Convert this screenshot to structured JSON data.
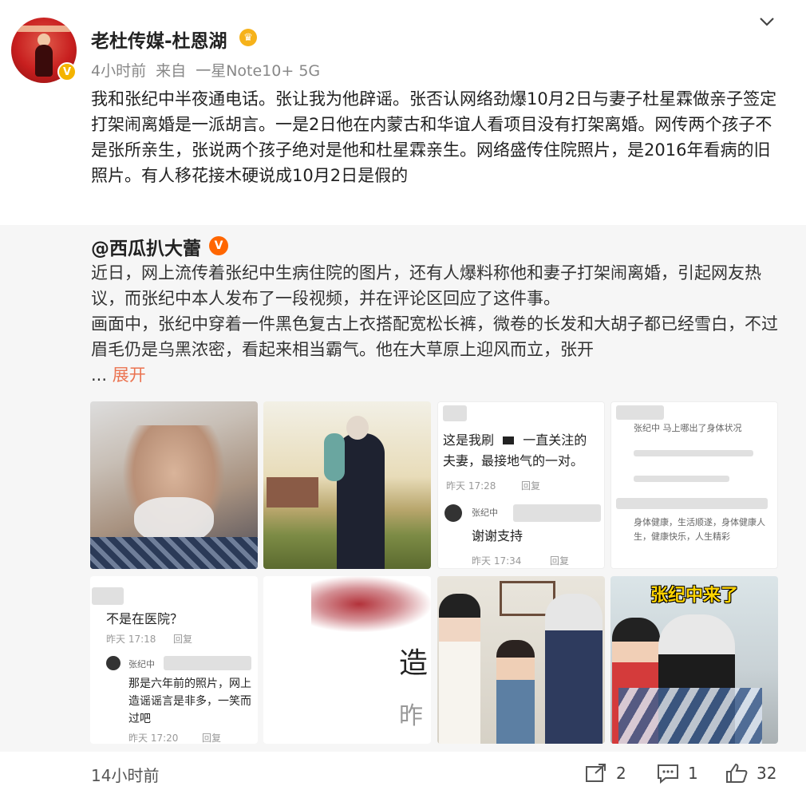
{
  "post": {
    "author": "老杜传媒-杜恩湖",
    "meta_time": "4小时前",
    "meta_source_label": "来自",
    "meta_device": "一星Note10+ 5G",
    "body": "我和张纪中半夜通电话。张让我为他辟谣。张否认网络劲爆10月2日与妻子杜星霖做亲子签定打架闹离婚是一派胡言。一是2日他在内蒙古和华谊人看项目没有打架离婚。网传两个孩子不是张所亲生，张说两个孩子绝对是他和杜星霖亲生。网络盛传住院照片，是2016年看病的旧照片。有人移花接木硬说成10月2日是假的"
  },
  "repost": {
    "author": "@西瓜扒大蕾",
    "text_p1": "近日，网上流传着张纪中生病住院的图片，还有人爆料称他和妻子打架闹离婚，引起网友热议，而张纪中本人发布了一段视频，并在评论区回应了这件事。",
    "text_p2": "画面中，张纪中穿着一件黑色复古上衣搭配宽松长裤，微卷的长发和大胡子都已经雪白，不过眉毛仍是乌黑浓密，看起来相当霸气。他在大草原上迎风而立，张开",
    "ellipsis": "...",
    "expand": "展开"
  },
  "screens": {
    "s3_c1": "这是我刷",
    "s3_c1b": "一直关注的",
    "s3_c2": "夫妻，最接地气的一对。",
    "s3_t1": "昨天 17:28",
    "s3_reply": "回复",
    "s3_user": "张纪中",
    "s3_c3": "谢谢支持",
    "s3_t2": "昨天 17:34",
    "s3_reply2": "回复",
    "s4_c1": "张纪中 马上哪出了身体状况",
    "s4_c2": "身体健康，生活顺遂，身体健康人生，健康快乐，人生精彩",
    "s5_c1": "不是在医院？",
    "s5_t1": "昨天 17:18",
    "s5_reply": "回复",
    "s5_user": "张纪中",
    "s5_c2": "那是六年前的照片，网上",
    "s5_c3": "造谣谣言是非多，一笑而",
    "s5_c4": "过吧",
    "s5_t2": "昨天 17:20",
    "s5_reply2": "回复",
    "s6_big1": "造",
    "s6_big2": "昨",
    "s8_title": "张纪中来了"
  },
  "footer": {
    "time": "14小时前",
    "repost_count": "2",
    "comment_count": "1",
    "like_count": "32"
  }
}
